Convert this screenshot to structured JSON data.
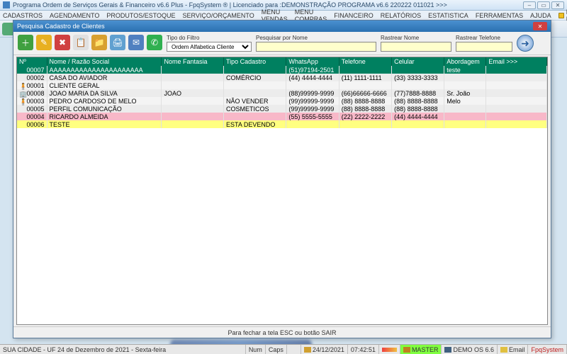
{
  "window": {
    "title": "Programa Ordem de Serviços Gerais & Financeiro v6.6 Plus - FpqSystem ® | Licenciado para :DEMONSTRAÇÃO PROGRAMA v6.6 220222 011021 >>>"
  },
  "menu": {
    "items": [
      "CADASTROS",
      "AGENDAMENTO",
      "PRODUTOS/ESTOQUE",
      "SERVIÇO/ORÇAMENTO",
      "MENU VENDAS",
      "MENU COMPRAS",
      "FINANCEIRO",
      "RELATÓRIOS",
      "ESTATISTICA",
      "FERRAMENTAS",
      "AJUDA"
    ],
    "email": "E-MAIL"
  },
  "dialog": {
    "title": "Pesquisa Cadastro de Clientes",
    "filter_type_label": "Tipo do Filtro",
    "filter_type_value": "Ordem Alfabetica Cliente",
    "search_name_label": "Pesquisar por Nome",
    "track_name_label": "Rastrear Nome",
    "track_phone_label": "Rastrear Telefone",
    "footer": "Para fechar a tela ESC ou botão SAIR"
  },
  "columns": [
    "Nº",
    "Nome / Razão Social",
    "Nome Fantasia",
    "Tipo Cadastro",
    "WhatsApp",
    "Telefone",
    "Celular",
    "Abordagem",
    "Email  >>>"
  ],
  "rows": [
    {
      "sel": true,
      "ico": "",
      "n": "00007",
      "nome": "AAAAAAAAAAAAAAAAAAAAAA",
      "fant": "",
      "tipo": "",
      "wa": "(51)97194-2501",
      "tel": "",
      "cel": "",
      "abd": "teste",
      "email": ""
    },
    {
      "ico": "",
      "n": "00002",
      "nome": "CASA DO AVIADOR",
      "fant": "",
      "tipo": "COMÉRCIO",
      "wa": "(44) 4444-4444",
      "tel": "(11) 1111-1111",
      "cel": "(33) 3333-3333",
      "abd": "",
      "email": ""
    },
    {
      "ico": "🧍",
      "n": "00001",
      "nome": "CLIENTE GERAL",
      "fant": "",
      "tipo": "",
      "wa": "",
      "tel": "",
      "cel": "",
      "abd": "",
      "email": ""
    },
    {
      "ico": "🏢",
      "n": "00008",
      "nome": "JOAO MARIA DA SILVA",
      "fant": "JOAO",
      "tipo": "",
      "wa": "(88)99999-9999",
      "tel": "(66)66666-6666",
      "cel": "(77)7888-8888",
      "abd": "Sr. João",
      "email": ""
    },
    {
      "ico": "🧍",
      "n": "00003",
      "nome": "PEDRO CARDOSO DE MELO",
      "fant": "",
      "tipo": "NÃO VENDER",
      "wa": "(99)99999-9999",
      "tel": "(88) 8888-8888",
      "cel": "(88) 8888-8888",
      "abd": "Melo",
      "email": ""
    },
    {
      "ico": "",
      "n": "00005",
      "nome": "PERFIL COMUNICAÇÃO",
      "fant": "",
      "tipo": "COSMETICOS",
      "wa": "(99)99999-9999",
      "tel": "(88) 8888-8888",
      "cel": "(88) 8888-8888",
      "abd": "",
      "email": ""
    },
    {
      "pink": true,
      "ico": "",
      "n": "00004",
      "nome": "RICARDO ALMEIDA",
      "fant": "",
      "tipo": "",
      "wa": "(55) 5555-5555",
      "tel": "(22) 2222-2222",
      "cel": "(44) 4444-4444",
      "abd": "",
      "email": ""
    },
    {
      "yellow": true,
      "ico": "",
      "n": "00006",
      "nome": "TESTE",
      "fant": "",
      "tipo": "ESTA DEVENDO",
      "wa": "",
      "tel": "",
      "cel": "",
      "abd": "",
      "email": ""
    }
  ],
  "status": {
    "city": "SUA CIDADE - UF 24 de Dezembro de 2021 - Sexta-feira",
    "num": "Num",
    "caps": "Caps",
    "date": "24/12/2021",
    "time": "07:42:51",
    "master": "MASTER",
    "demo": "DEMO OS 6.6",
    "email": "Email",
    "fpq": "FpqSystem"
  },
  "toolbar_colors": [
    "#40a060",
    "#e8c040",
    "#d07030",
    "#c0a020",
    "#e09020",
    "#e0a030",
    "#d89830",
    "#60a060",
    "#d08030",
    "#d04040",
    "#e0a030",
    "#5090c0",
    "#d09030",
    "#70a040",
    "#60a0d0",
    "#d89040",
    "#60a860",
    "#c0a0d0",
    "#5098c8",
    "#e0a040",
    "#d0a840",
    "#e8c040",
    "#50a0d0",
    "#d8a040",
    "#60a870",
    "#e8c040",
    "#50a0d0",
    "#d8a040",
    "#60a870",
    "#d07840"
  ],
  "dialog_icons": [
    {
      "bg": "#40a040",
      "g": "＋"
    },
    {
      "bg": "#e8b020",
      "g": "✎"
    },
    {
      "bg": "#d04040",
      "g": "✖"
    },
    {
      "bg": "#e0e0e0",
      "g": "📋"
    },
    {
      "bg": "#d8a030",
      "g": "📁"
    },
    {
      "bg": "#60a0d0",
      "g": "🖨"
    },
    {
      "bg": "#5080c0",
      "g": "✉"
    },
    {
      "bg": "#30b050",
      "g": "✆"
    }
  ]
}
